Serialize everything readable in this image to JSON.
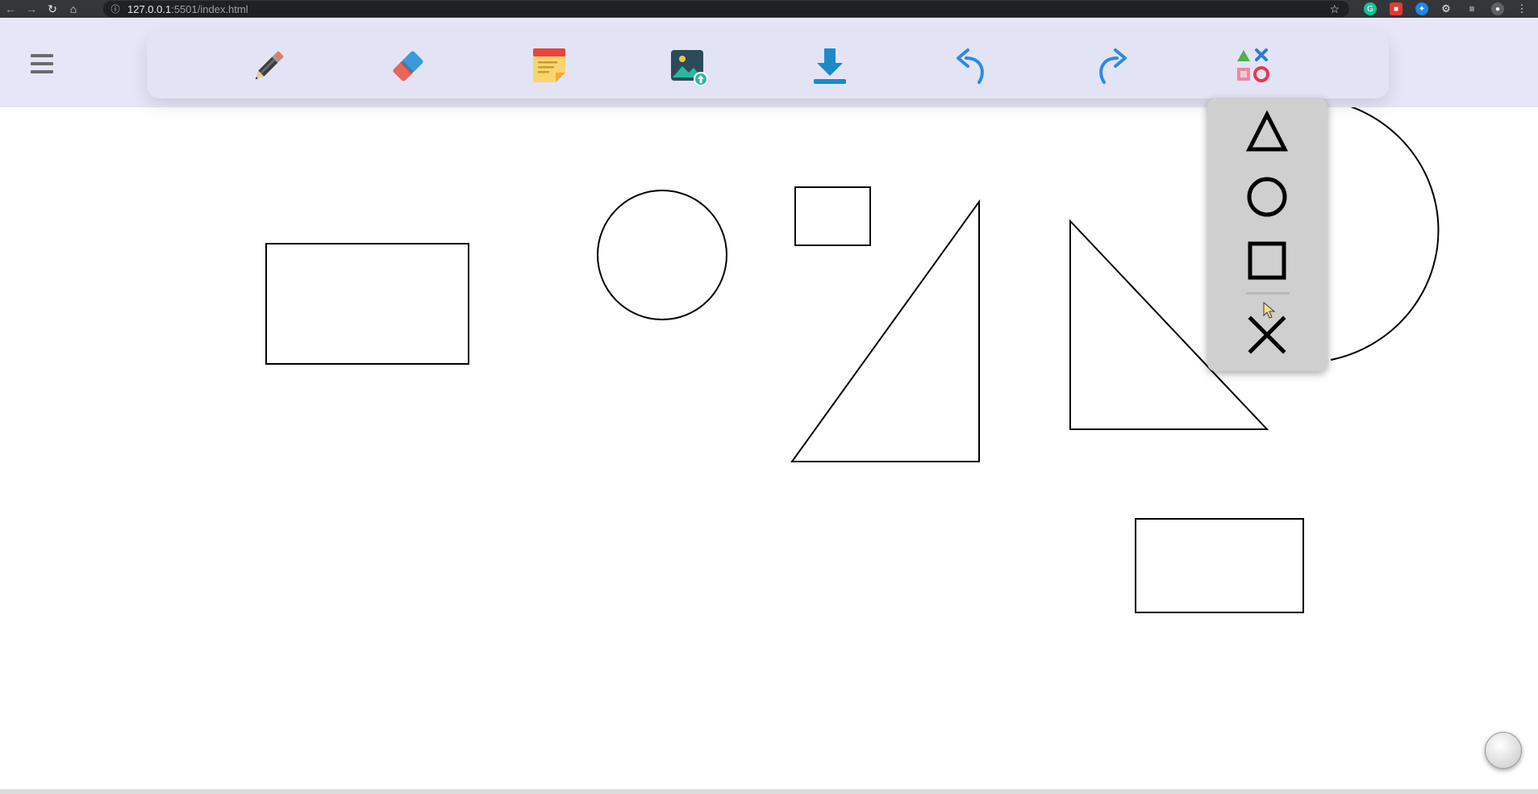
{
  "browser": {
    "url_host": "127.0.0.1",
    "url_rest": ":5501/index.html",
    "back_icon": "arrow-left-icon",
    "forward_icon": "arrow-right-icon",
    "reload_icon": "reload-icon",
    "home_icon": "home-icon",
    "bookmark_icon": "star-icon",
    "extensions": [
      "grammarly-icon",
      "screen-recorder-icon",
      "extension-blue-icon",
      "puzzle-icon",
      "media-control-icon",
      "profile-icon",
      "more-menu-icon"
    ]
  },
  "app": {
    "menu_icon": "hamburger-icon",
    "header_color": "#e6e6f8",
    "toolbar": [
      {
        "name": "pencil",
        "icon": "pencil-icon"
      },
      {
        "name": "eraser",
        "icon": "eraser-icon"
      },
      {
        "name": "sticky-note",
        "icon": "sticky-note-icon"
      },
      {
        "name": "upload-image",
        "icon": "image-upload-icon"
      },
      {
        "name": "download",
        "icon": "download-icon"
      },
      {
        "name": "undo",
        "icon": "undo-icon"
      },
      {
        "name": "redo",
        "icon": "redo-icon"
      },
      {
        "name": "shapes",
        "icon": "shapes-icon"
      }
    ],
    "shape_menu": {
      "items": [
        {
          "name": "triangle",
          "icon": "triangle-icon"
        },
        {
          "name": "circle",
          "icon": "circle-icon"
        },
        {
          "name": "square",
          "icon": "square-icon"
        },
        {
          "name": "close",
          "icon": "close-icon"
        }
      ]
    },
    "fab_icon": "floating-action-button"
  }
}
